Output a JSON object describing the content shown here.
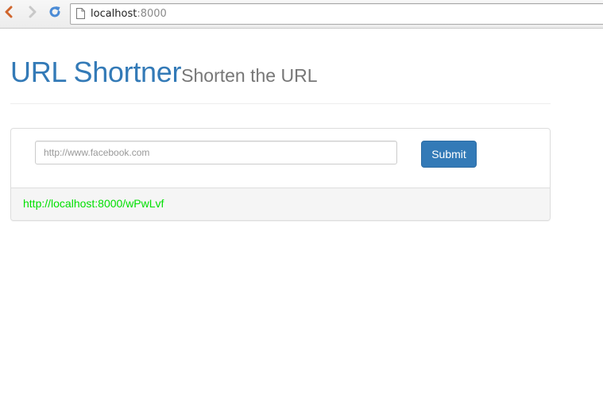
{
  "browser": {
    "address_host": "localhost",
    "address_port": ":8000"
  },
  "header": {
    "title": "URL Shortner",
    "subtitle": "Shorten the URL"
  },
  "form": {
    "url_placeholder": "http://www.facebook.com",
    "url_value": "",
    "submit_label": "Submit"
  },
  "result": {
    "short_url": "http://localhost:8000/wPwLvf"
  },
  "colors": {
    "primary": "#337ab7",
    "link_green": "#00e000",
    "subtitle_gray": "#777777"
  }
}
